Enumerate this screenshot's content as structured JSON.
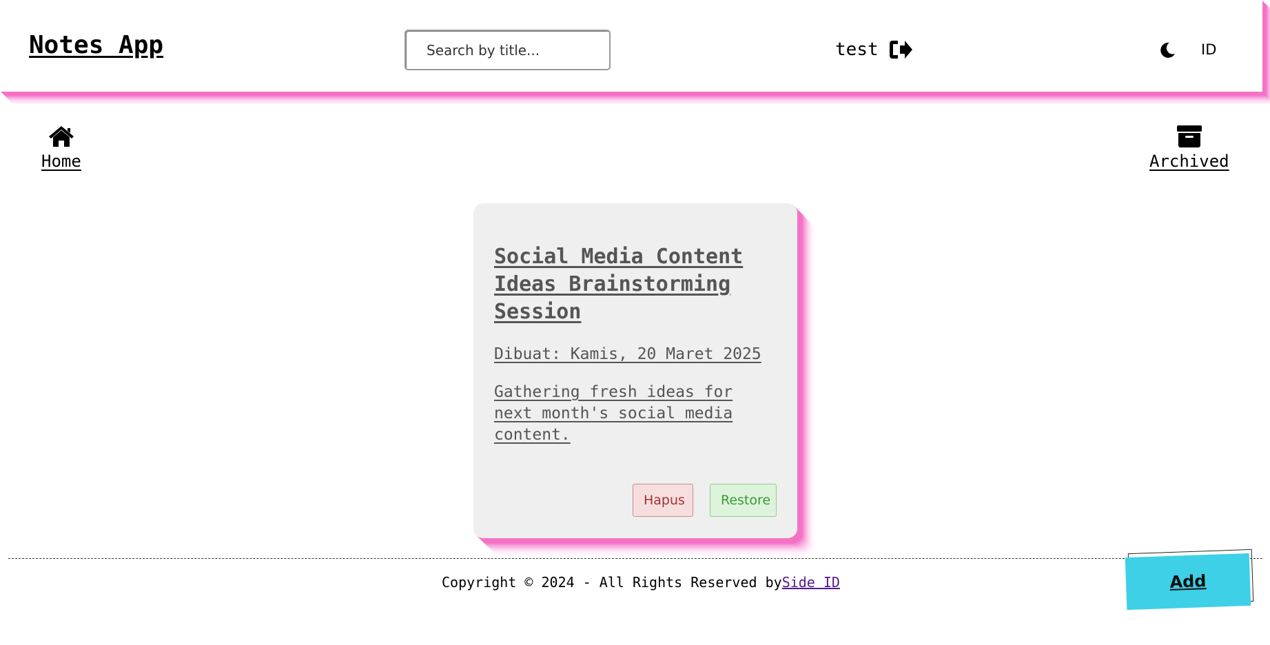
{
  "header": {
    "brand": "Notes App",
    "search_placeholder": "Search by title...",
    "search_value": "",
    "user_name": "test",
    "logout_icon": "logout-icon",
    "theme_icon": "moon-icon",
    "language": "ID"
  },
  "nav": {
    "home": {
      "label": "Home",
      "icon": "home-icon"
    },
    "archived": {
      "label": "Archived",
      "icon": "archive-icon"
    }
  },
  "notes": [
    {
      "title": "Social Media Content Ideas Brainstorming Session",
      "date": "Dibuat: Kamis, 20 Maret 2025",
      "body": "Gathering fresh ideas for next month's social media content.",
      "delete_label": "Hapus",
      "restore_label": "Restore"
    }
  ],
  "footer": {
    "text": "Copyright © 2024 - All Rights Reserved by",
    "link_text": "Side ID"
  },
  "add_button": {
    "label": "Add"
  },
  "colors": {
    "accent_shadow": "#f472c6",
    "add_button": "#3ed0e6",
    "card_bg": "#efefef",
    "delete_bg": "#f6dede",
    "restore_bg": "#def3dc"
  }
}
